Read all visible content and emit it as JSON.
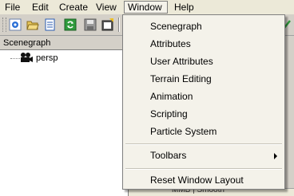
{
  "menubar": {
    "items": [
      {
        "label": "File"
      },
      {
        "label": "Edit"
      },
      {
        "label": "Create"
      },
      {
        "label": "View"
      },
      {
        "label": "Window"
      },
      {
        "label": "Help"
      }
    ]
  },
  "toolbar": {
    "buttons": [
      {
        "icon": "gear-icon"
      },
      {
        "icon": "open-folder-icon"
      },
      {
        "icon": "document-list-icon"
      },
      {
        "icon": "refresh-icon"
      },
      {
        "icon": "save-disk-icon"
      },
      {
        "icon": "export-icon"
      }
    ],
    "right_icon": "checkmark-icon"
  },
  "scenegraph_panel": {
    "header": "Scenegraph",
    "nodes": [
      {
        "icon": "camera-icon",
        "label": "persp"
      }
    ]
  },
  "status": {
    "text": "MMB | Smooth"
  },
  "window_menu": {
    "items": [
      {
        "label": "Scenegraph"
      },
      {
        "label": "Attributes"
      },
      {
        "label": "User Attributes"
      },
      {
        "label": "Terrain Editing"
      },
      {
        "label": "Animation"
      },
      {
        "label": "Scripting"
      },
      {
        "label": "Particle System"
      }
    ],
    "toolbars_label": "Toolbars",
    "reset_label": "Reset Window Layout"
  },
  "colors": {
    "menu_background": "#f4f2ea",
    "chrome": "#d4d0c8",
    "menubar": "#ece9d8"
  }
}
